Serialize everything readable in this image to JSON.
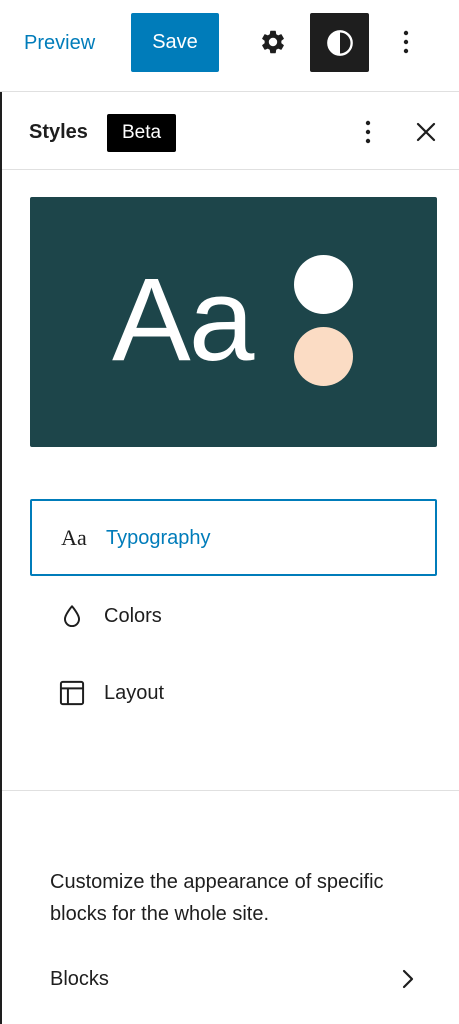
{
  "topbar": {
    "preview_label": "Preview",
    "save_label": "Save",
    "icons": {
      "settings": "gear-icon",
      "styles": "half-circle-contrast-icon",
      "more": "vertical-ellipsis-icon"
    }
  },
  "sidebar": {
    "title": "Styles",
    "badge": "Beta",
    "icons": {
      "more": "vertical-ellipsis-icon",
      "close": "close-icon"
    },
    "preview": {
      "sample_text": "Aa",
      "background_color": "#1d454a",
      "primary_color": "#ffffff",
      "secondary_color": "#fbdcc4"
    },
    "nav_items": [
      {
        "label": "Typography",
        "icon": "typography-aa-icon",
        "active": true
      },
      {
        "label": "Colors",
        "icon": "droplet-icon",
        "active": false
      },
      {
        "label": "Layout",
        "icon": "layout-icon",
        "active": false
      }
    ],
    "blocks_description": "Customize the appearance of specific blocks for the whole site.",
    "blocks_label": "Blocks"
  },
  "colors": {
    "accent": "#007cba",
    "dark": "#1e1e1e",
    "border": "#e0e0e0"
  }
}
